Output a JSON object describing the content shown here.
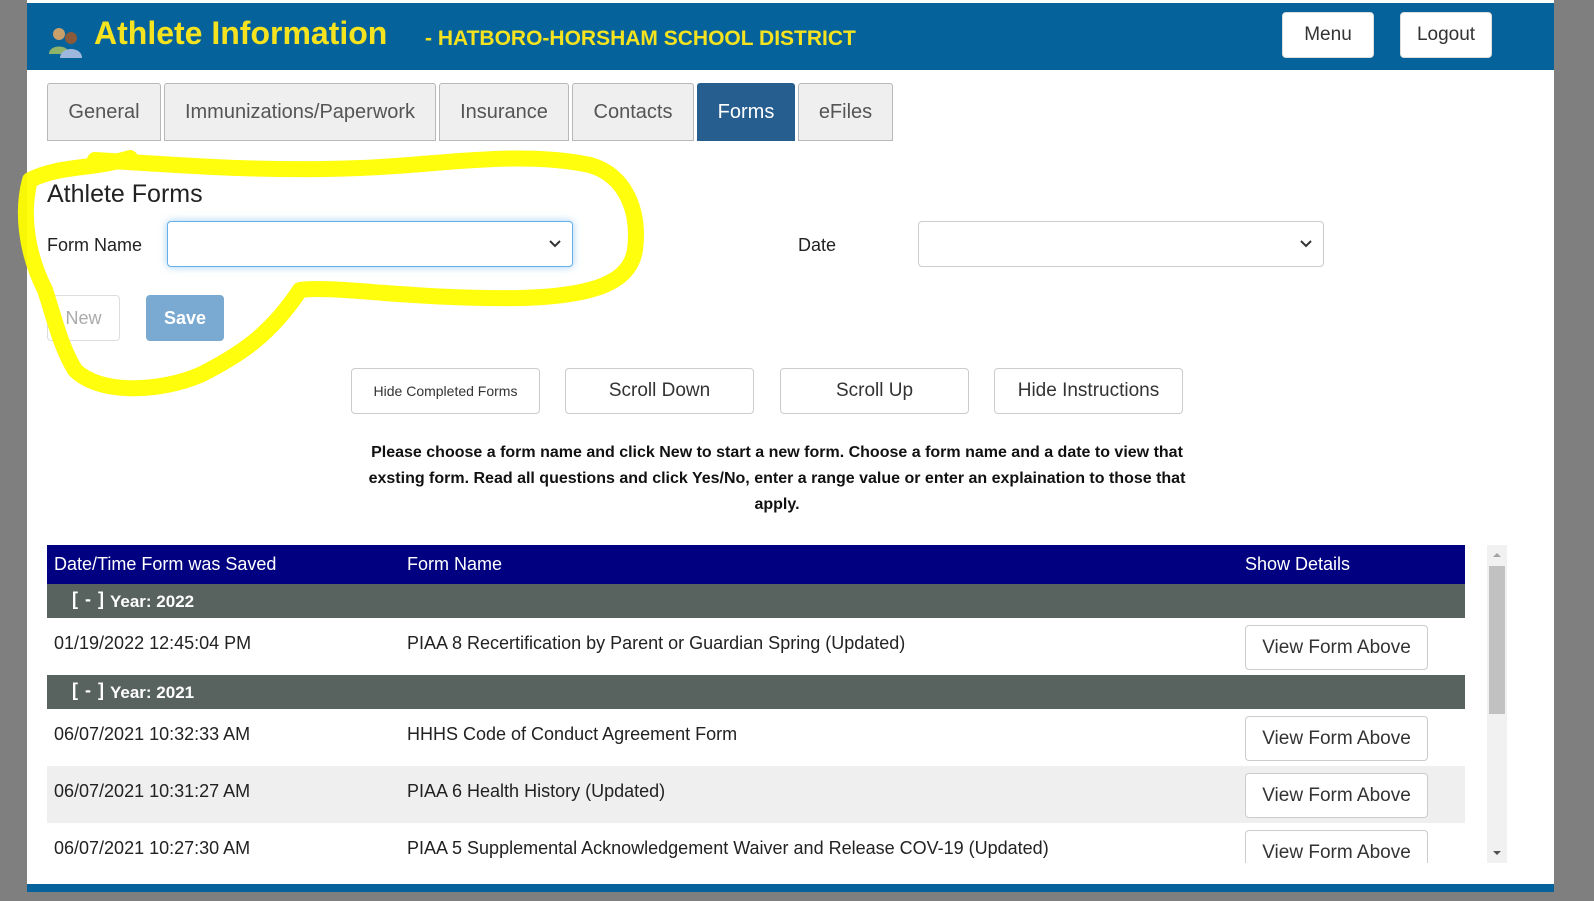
{
  "header": {
    "title": "Athlete Information",
    "subtitle": "- HATBORO-HORSHAM SCHOOL DISTRICT",
    "logo_icon": "users-icon",
    "menu_label": "Menu",
    "logout_label": "Logout",
    "colors": {
      "bar": "#05629a",
      "title": "#f5e31f"
    }
  },
  "tabs": [
    {
      "label": "General",
      "active": false
    },
    {
      "label": "Immunizations/Paperwork",
      "active": false
    },
    {
      "label": "Insurance",
      "active": false
    },
    {
      "label": "Contacts",
      "active": false
    },
    {
      "label": "Forms",
      "active": true
    },
    {
      "label": "eFiles",
      "active": false
    }
  ],
  "forms": {
    "section_title": "Athlete Forms",
    "form_name_label": "Form Name",
    "form_name_value": "",
    "date_label": "Date",
    "date_value": "",
    "new_label": "New",
    "save_label": "Save"
  },
  "actions": {
    "hide_completed": "Hide Completed Forms",
    "scroll_down": "Scroll Down",
    "scroll_up": "Scroll Up",
    "hide_instructions": "Hide Instructions"
  },
  "instructions": "Please choose a form name and click New to start a new form. Choose a form name and a date to view that exsting form. Read all questions and click Yes/No, enter a range value or enter an explaination to those that apply.",
  "grid": {
    "columns": [
      "Date/Time Form was Saved",
      "Form Name",
      "Show Details"
    ],
    "toggle": "[ - ]",
    "groups": [
      {
        "label": "Year: 2022",
        "rows": [
          {
            "datetime": "01/19/2022 12:45:04 PM",
            "form": "PIAA 8 Recertification by Parent or Guardian Spring (Updated)",
            "action": "View Form Above"
          }
        ]
      },
      {
        "label": "Year: 2021",
        "rows": [
          {
            "datetime": "06/07/2021 10:32:33 AM",
            "form": "HHHS Code of Conduct Agreement Form",
            "action": "View Form Above"
          },
          {
            "datetime": "06/07/2021 10:31:27 AM",
            "form": "PIAA 6 Health History (Updated)",
            "action": "View Form Above"
          },
          {
            "datetime": "06/07/2021 10:27:30 AM",
            "form": "PIAA 5 Supplemental Acknowledgement Waiver and Release COV-19 (Updated)",
            "action": "View Form Above"
          }
        ]
      }
    ],
    "colors": {
      "header": "#000080",
      "group": "#58625f"
    }
  },
  "annotation": {
    "type": "yellow-highlight-scribble",
    "color": "#ffff00"
  }
}
